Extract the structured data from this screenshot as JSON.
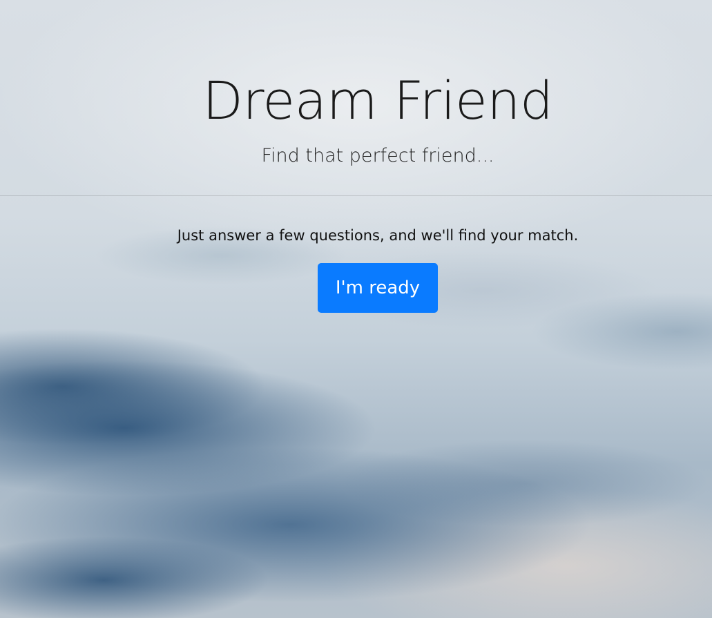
{
  "hero": {
    "title": "Dream Friend",
    "subtitle": "Find that perfect friend...",
    "lead": "Just answer a few questions, and we'll find your match.",
    "cta_label": "I'm ready"
  },
  "colors": {
    "button_bg": "#0a7bff",
    "button_text": "#ffffff",
    "text": "#111111"
  }
}
